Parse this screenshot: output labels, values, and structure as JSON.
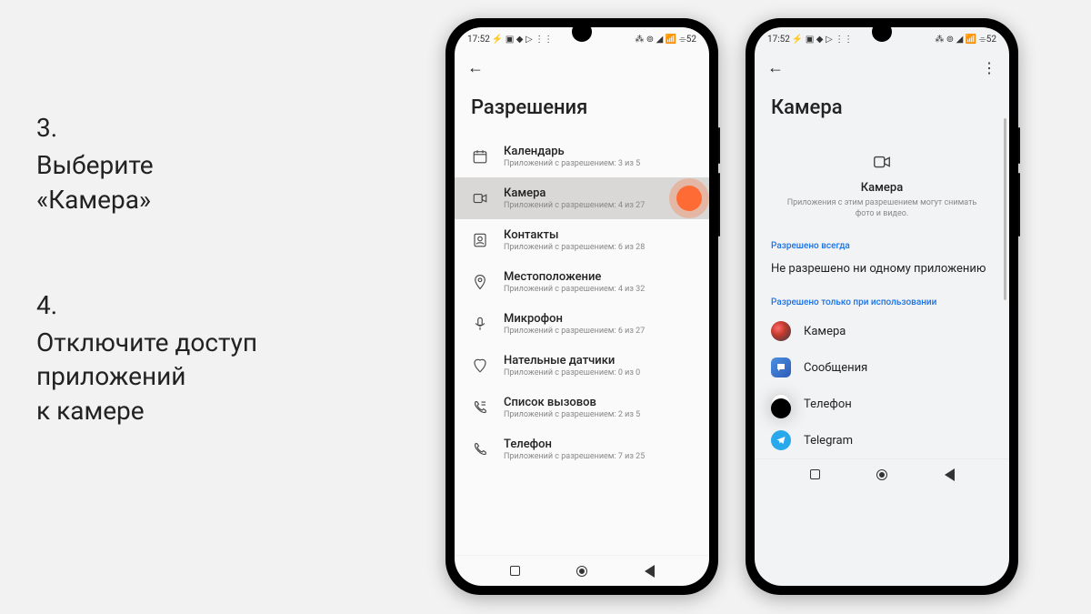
{
  "instructions": {
    "step3": {
      "num": "3.",
      "text_l1": "Выберите",
      "text_l2": "«Камера»"
    },
    "step4": {
      "num": "4.",
      "text_l1": "Отключите доступ",
      "text_l2": "приложений",
      "text_l3": "к камере"
    }
  },
  "phone1": {
    "status_time": "17:52",
    "status_icons_left": "⚡ ▣ ◆ ▷ ⋮⋮",
    "status_icons_right": "⁂ ⊚ ◢ 📶 ⌯52",
    "page_title": "Разрешения",
    "items": [
      {
        "icon": "calendar",
        "title": "Календарь",
        "sub": "Приложений с разрешением: 3 из 5"
      },
      {
        "icon": "camera",
        "title": "Камера",
        "sub": "Приложений с разрешением: 4 из 27",
        "highlighted": true
      },
      {
        "icon": "contacts",
        "title": "Контакты",
        "sub": "Приложений с разрешением: 6 из 28"
      },
      {
        "icon": "location",
        "title": "Местоположение",
        "sub": "Приложений с разрешением: 4 из 32"
      },
      {
        "icon": "mic",
        "title": "Микрофон",
        "sub": "Приложений с разрешением: 6 из 27"
      },
      {
        "icon": "body",
        "title": "Нательные датчики",
        "sub": "Приложений с разрешением: 0 из 0"
      },
      {
        "icon": "calllog",
        "title": "Список вызовов",
        "sub": "Приложений с разрешением: 2 из 5"
      },
      {
        "icon": "phone",
        "title": "Телефон",
        "sub": "Приложений с разрешением: 7 из 25"
      }
    ]
  },
  "phone2": {
    "status_time": "17:52",
    "status_icons_left": "⚡ ▣ ◆ ▷ ⋮⋮",
    "status_icons_right": "⁂ ⊚ ◢ 📶 ⌯52",
    "page_title": "Камера",
    "header_name": "Камера",
    "header_desc": "Приложения с этим разрешением могут снимать фото и видео.",
    "section_allowed_always": "Разрешено всегда",
    "empty_text": "Не разрешено ни одному приложению",
    "section_allowed_inuse": "Разрешено только при использовании",
    "apps": [
      {
        "icon": "camera",
        "label": "Камера"
      },
      {
        "icon": "messages",
        "label": "Сообщения"
      },
      {
        "icon": "phone",
        "label": "Телефон"
      },
      {
        "icon": "telegram",
        "label": "Telegram"
      }
    ]
  }
}
